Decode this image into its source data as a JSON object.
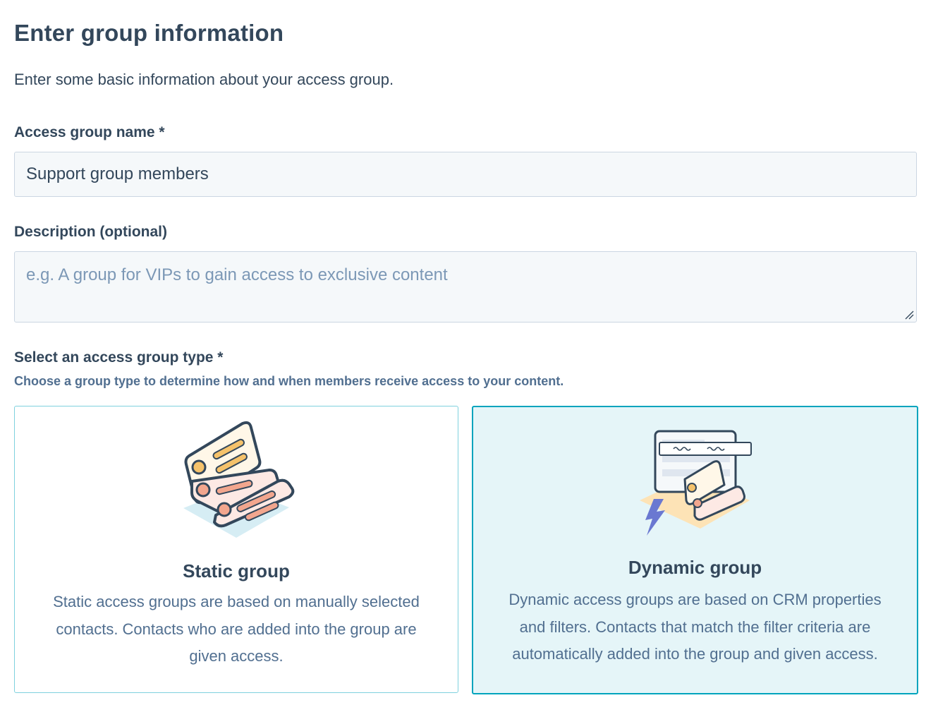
{
  "page": {
    "title": "Enter group information",
    "subtitle": "Enter some basic information about your access group."
  },
  "name_field": {
    "label": "Access group name *",
    "value": "Support group members"
  },
  "description_field": {
    "label": "Description (optional)",
    "placeholder": "e.g. A group for VIPs to gain access to exclusive content"
  },
  "group_type": {
    "label": "Select an access group type *",
    "help": "Choose a group type to determine how and when members receive access to your content.",
    "selected": "Dynamic group",
    "options": [
      {
        "title": "Static group",
        "description": "Static access groups are based on manually selected contacts. Contacts who are added into the group are given access.",
        "icon": "static-group-illustration"
      },
      {
        "title": "Dynamic group",
        "description": "Dynamic access groups are based on CRM properties and filters. Contacts that match the filter criteria are automatically added into the group and given access.",
        "icon": "dynamic-group-illustration"
      }
    ]
  },
  "colors": {
    "text": "#33475b",
    "muted": "#516f90",
    "input_bg": "#f5f8fa",
    "input_border": "#cbd6e2",
    "selected_border": "#00a4bd",
    "selected_bg": "#e5f5f8"
  }
}
